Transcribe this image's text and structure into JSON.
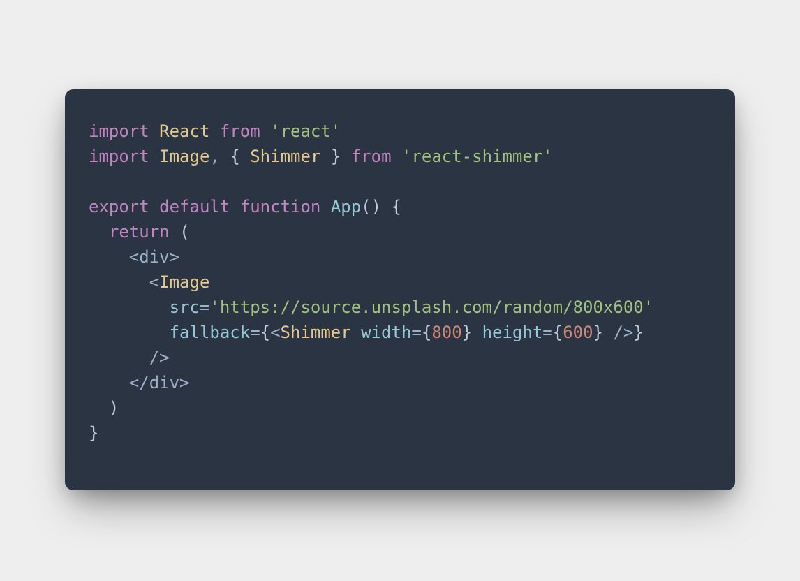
{
  "code": {
    "line1": {
      "kw_import": "import",
      "cls_react": "React",
      "kw_from": "from",
      "str_react": "'react'"
    },
    "line2": {
      "kw_import": "import",
      "cls_image": "Image",
      "punc_comma": ",",
      "brace_open": "{",
      "cls_shimmer": "Shimmer",
      "brace_close": "}",
      "kw_from": "from",
      "str_shimmer": "'react-shimmer'"
    },
    "line4": {
      "kw_export": "export",
      "kw_default": "default",
      "kw_function": "function",
      "fn_app": "App",
      "paren_open": "(",
      "paren_close": ")",
      "brace_open": "{"
    },
    "line5": {
      "indent": "  ",
      "kw_return": "return",
      "paren_open": "("
    },
    "line6": {
      "indent": "    ",
      "tag_div_open": "<div>"
    },
    "line7": {
      "indent": "      ",
      "tag_open_angle": "<",
      "cls_image": "Image"
    },
    "line8": {
      "indent": "        ",
      "attr_src": "src",
      "eq": "=",
      "str_url": "'https://source.unsplash.com/random/800x600'"
    },
    "line9": {
      "indent": "        ",
      "attr_fallback": "fallback",
      "eq": "=",
      "brace_open1": "{",
      "tag_open_angle": "<",
      "cls_shimmer": "Shimmer",
      "sp1": " ",
      "attr_width": "width",
      "eq2": "=",
      "brace_open2": "{",
      "num_800": "800",
      "brace_close2": "}",
      "sp2": " ",
      "attr_height": "height",
      "eq3": "=",
      "brace_open3": "{",
      "num_600": "600",
      "brace_close3": "}",
      "sp3": " ",
      "tag_selfclose": "/>",
      "brace_close1": "}"
    },
    "line10": {
      "indent": "      ",
      "tag_selfclose": "/>"
    },
    "line11": {
      "indent": "    ",
      "tag_div_close": "</div>"
    },
    "line12": {
      "indent": "  ",
      "paren_close": ")"
    },
    "line13": {
      "brace_close": "}"
    }
  },
  "colors": {
    "background_page": "#eeeeee",
    "background_card": "#2b3442",
    "keyword": "#c285c1",
    "class": "#e2c890",
    "string": "#a0c180",
    "attribute": "#96c7d6",
    "number": "#d08676",
    "default_text": "#9eb0c6"
  }
}
